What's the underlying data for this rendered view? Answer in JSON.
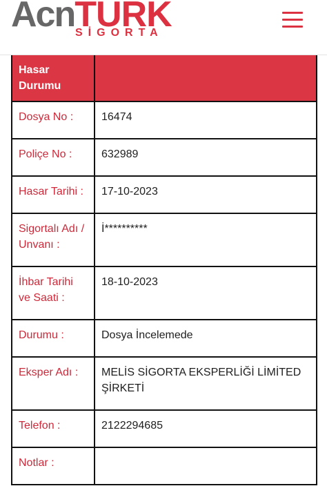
{
  "header": {
    "logo_main_left": "Acn",
    "logo_main_right": "TURK",
    "logo_sub": "SİGORTA",
    "menu_icon": "hamburger-menu-icon"
  },
  "table": {
    "header_label": "Hasar Durumu",
    "header_value": "",
    "rows": [
      {
        "label": "Dosya No :",
        "value": "16474"
      },
      {
        "label": "Poliçe No :",
        "value": "632989"
      },
      {
        "label": "Hasar Tarihi :",
        "value": "17-10-2023"
      },
      {
        "label": "Sigortalı Adı / Unvanı :",
        "value": "İ**********"
      },
      {
        "label": "İhbar Tarihi ve Saati :",
        "value": "18-10-2023"
      },
      {
        "label": "Durumu :",
        "value": "Dosya İncelemede"
      },
      {
        "label": "Eksper Adı :",
        "value": "MELİS SİGORTA EKSPERLİĞİ LİMİTED ŞİRKETİ"
      },
      {
        "label": "Telefon :",
        "value": "2122294685"
      },
      {
        "label": "Notlar :",
        "value": ""
      }
    ]
  },
  "colors": {
    "brand_red": "#db3140",
    "logo_gray": "#676767",
    "label_red": "#cc2a3a"
  }
}
